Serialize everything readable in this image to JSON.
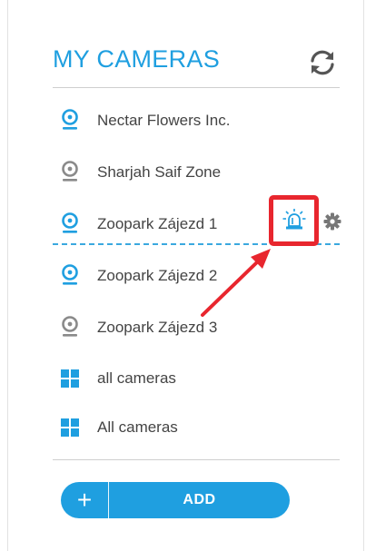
{
  "header": {
    "title": "MY CAMERAS",
    "refresh_icon": "refresh-icon"
  },
  "cameras": [
    {
      "label": "Nectar Flowers Inc.",
      "status": "online",
      "icon": "webcam-icon"
    },
    {
      "label": "Sharjah Saif Zone",
      "status": "offline",
      "icon": "webcam-icon"
    },
    {
      "label": "Zoopark Zájezd 1",
      "status": "online",
      "icon": "webcam-icon",
      "selected": true,
      "actions": [
        "alarm-siren-icon",
        "gear-icon"
      ]
    },
    {
      "label": "Zoopark Zájezd 2",
      "status": "online",
      "icon": "webcam-icon"
    },
    {
      "label": "Zoopark Zájezd 3",
      "status": "offline",
      "icon": "webcam-icon"
    }
  ],
  "groups": [
    {
      "label": "all cameras",
      "icon": "grid-icon"
    },
    {
      "label": "All cameras",
      "icon": "grid-icon"
    }
  ],
  "footer": {
    "add_label": "ADD",
    "plus_label": "+"
  },
  "colors": {
    "accent": "#1f9fe0",
    "online_icon": "#1f9fe0",
    "offline_icon": "#8a8a8a",
    "highlight": "#e8262e",
    "text": "#444444"
  }
}
